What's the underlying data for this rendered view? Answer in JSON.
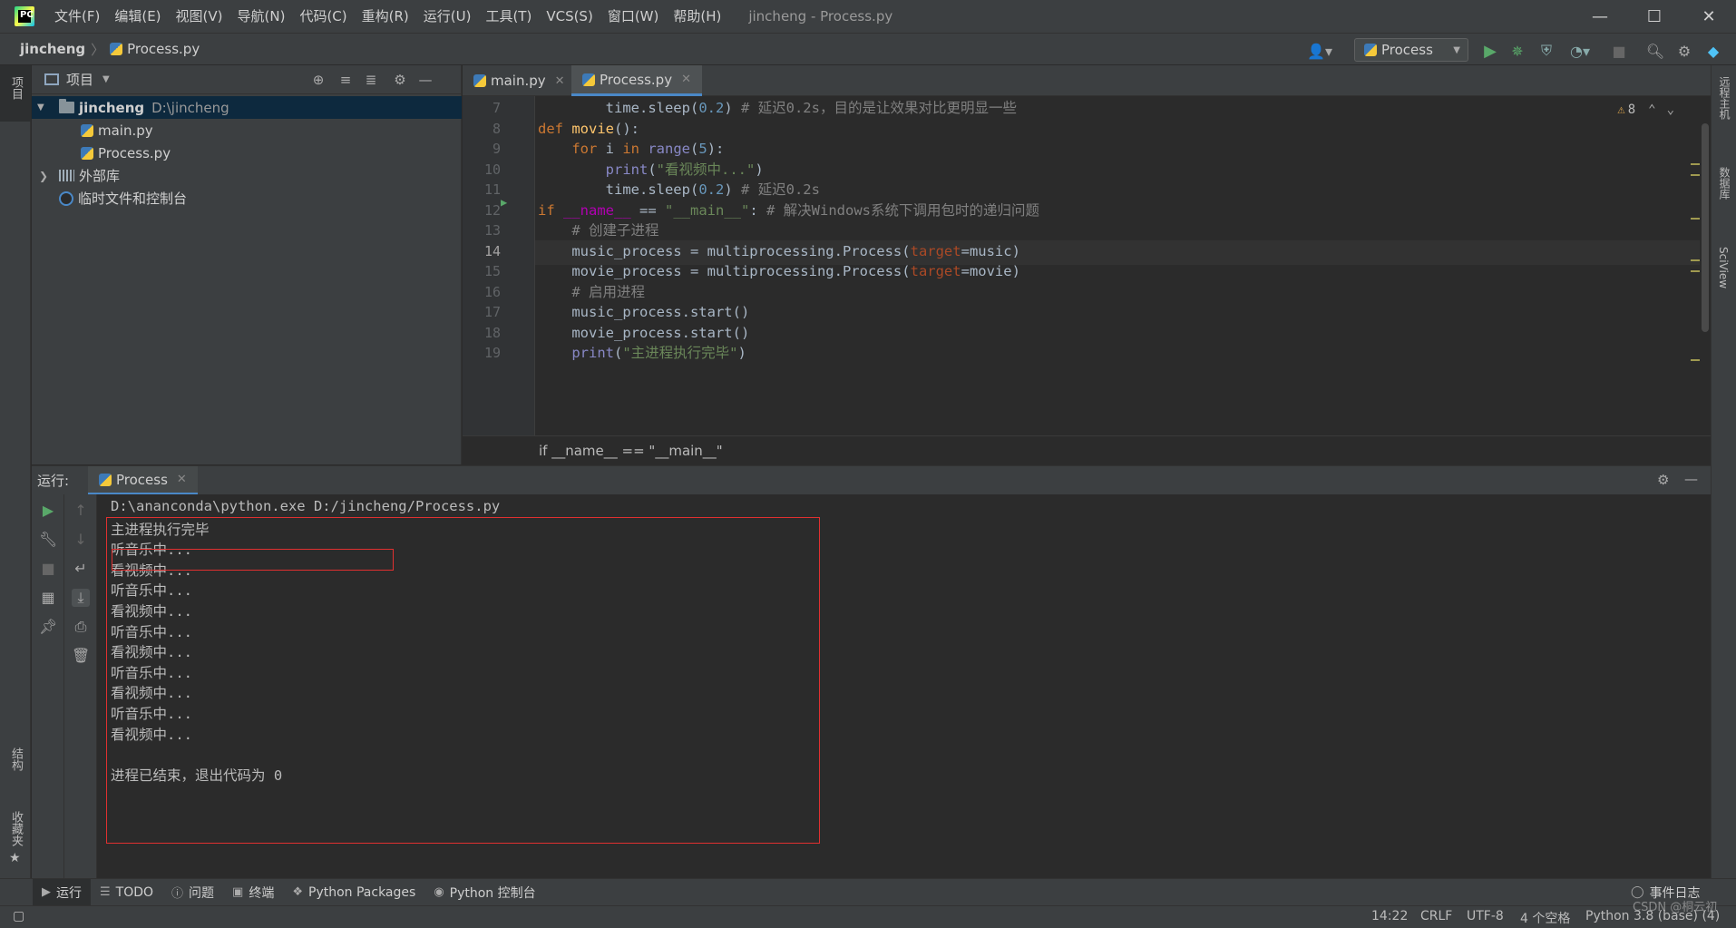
{
  "menu": [
    "文件(F)",
    "编辑(E)",
    "视图(V)",
    "导航(N)",
    "代码(C)",
    "重构(R)",
    "运行(U)",
    "工具(T)",
    "VCS(S)",
    "窗口(W)",
    "帮助(H)"
  ],
  "window_title": "jincheng - Process.py",
  "breadcrumb": {
    "project": "jincheng",
    "file": "Process.py"
  },
  "run_config": "Process",
  "left_strip": {
    "project": "项目",
    "structure": "结构",
    "favorites": "收藏夹"
  },
  "right_strip": {
    "remote": "远程主机",
    "database": "数据库",
    "sciview": "SciView"
  },
  "project_panel": {
    "title": "项目",
    "root": {
      "name": "jincheng",
      "path": "D:\\jincheng"
    },
    "files": [
      "main.py",
      "Process.py"
    ],
    "external_libs": "外部库",
    "scratches": "临时文件和控制台"
  },
  "editor_tabs": [
    {
      "label": "main.py",
      "active": false
    },
    {
      "label": "Process.py",
      "active": true
    }
  ],
  "warnings_count": "8",
  "code": {
    "current_line": 14,
    "lines": [
      {
        "n": "7",
        "text": "        time.sleep(0.2) # 延迟0.2s，目的是让效果对比更明显一些"
      },
      {
        "n": "8",
        "text": "def movie():"
      },
      {
        "n": "9",
        "text": "    for i in range(5):"
      },
      {
        "n": "10",
        "text": "        print(\"看视频中...\")"
      },
      {
        "n": "11",
        "text": "        time.sleep(0.2) # 延迟0.2s"
      },
      {
        "n": "12",
        "text": "if __name__ == \"__main__\": # 解决Windows系统下调用包时的递归问题"
      },
      {
        "n": "13",
        "text": "    # 创建子进程"
      },
      {
        "n": "14",
        "text": "    music_process = multiprocessing.Process(target=music)"
      },
      {
        "n": "15",
        "text": "    movie_process = multiprocessing.Process(target=movie)"
      },
      {
        "n": "16",
        "text": "    # 启用进程"
      },
      {
        "n": "17",
        "text": "    music_process.start()"
      },
      {
        "n": "18",
        "text": "    movie_process.start()"
      },
      {
        "n": "19",
        "text": "    print(\"主进程执行完毕\")"
      }
    ]
  },
  "editor_breadcrumb": "if __name__ == \"__main__\"",
  "run_panel": {
    "label": "运行:",
    "tab": "Process",
    "output": [
      "D:\\ananconda\\python.exe D:/jincheng/Process.py",
      "主进程执行完毕",
      "听音乐中...",
      "看视频中...",
      "听音乐中...",
      "看视频中...",
      "听音乐中...",
      "看视频中...",
      "听音乐中...",
      "看视频中...",
      "听音乐中...",
      "看视频中...",
      "",
      "进程已结束，退出代码为 0"
    ]
  },
  "bottom_tabs": [
    "运行",
    "TODO",
    "问题",
    "终端",
    "Python Packages",
    "Python 控制台"
  ],
  "event_log": "事件日志",
  "status": {
    "position": "14:22",
    "line_sep": "CRLF",
    "encoding": "UTF-8",
    "indent": "4 个空格",
    "interpreter": "Python 3.8 (base) (4)"
  },
  "watermark": "CSDN @桐云初"
}
